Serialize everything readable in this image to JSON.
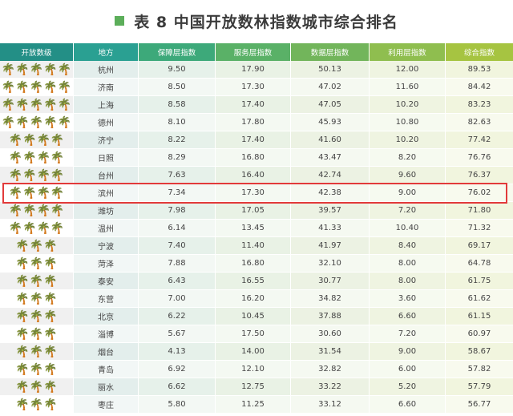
{
  "title": "表 8  中国开放数林指数城市综合排名",
  "headers": [
    "开放数级",
    "地方",
    "保障层指数",
    "服务层指数",
    "数据层指数",
    "利用层指数",
    "综合指数"
  ],
  "header_colors": [
    "#238f86",
    "#2aa092",
    "#3da97a",
    "#5ab167",
    "#72b55b",
    "#8fbe4f",
    "#a6c441"
  ],
  "rank_glyph": "🌴",
  "rows": [
    {
      "rank": "🌴🌴🌴🌴🌴",
      "city": "杭州",
      "v1": "9.50",
      "v2": "17.90",
      "v3": "50.13",
      "v4": "12.00",
      "v5": "89.53"
    },
    {
      "rank": "🌴🌴🌴🌴🌴",
      "city": "济南",
      "v1": "8.50",
      "v2": "17.30",
      "v3": "47.02",
      "v4": "11.60",
      "v5": "84.42"
    },
    {
      "rank": "🌴🌴🌴🌴🌴",
      "city": "上海",
      "v1": "8.58",
      "v2": "17.40",
      "v3": "47.05",
      "v4": "10.20",
      "v5": "83.23"
    },
    {
      "rank": "🌴🌴🌴🌴🌴",
      "city": "德州",
      "v1": "8.10",
      "v2": "17.80",
      "v3": "45.93",
      "v4": "10.80",
      "v5": "82.63"
    },
    {
      "rank": "🌴🌴🌴🌴",
      "city": "济宁",
      "v1": "8.22",
      "v2": "17.40",
      "v3": "41.60",
      "v4": "10.20",
      "v5": "77.42"
    },
    {
      "rank": "🌴🌴🌴🌴",
      "city": "日照",
      "v1": "8.29",
      "v2": "16.80",
      "v3": "43.47",
      "v4": "8.20",
      "v5": "76.76"
    },
    {
      "rank": "🌴🌴🌴🌴",
      "city": "台州",
      "v1": "7.63",
      "v2": "16.40",
      "v3": "42.74",
      "v4": "9.60",
      "v5": "76.37"
    },
    {
      "rank": "🌴🌴🌴🌴",
      "city": "滨州",
      "v1": "7.34",
      "v2": "17.30",
      "v3": "42.38",
      "v4": "9.00",
      "v5": "76.02"
    },
    {
      "rank": "🌴🌴🌴🌴",
      "city": "潍坊",
      "v1": "7.98",
      "v2": "17.05",
      "v3": "39.57",
      "v4": "7.20",
      "v5": "71.80"
    },
    {
      "rank": "🌴🌴🌴🌴",
      "city": "温州",
      "v1": "6.14",
      "v2": "13.45",
      "v3": "41.33",
      "v4": "10.40",
      "v5": "71.32"
    },
    {
      "rank": "🌴🌴🌴",
      "city": "宁波",
      "v1": "7.40",
      "v2": "11.40",
      "v3": "41.97",
      "v4": "8.40",
      "v5": "69.17"
    },
    {
      "rank": "🌴🌴🌴",
      "city": "菏泽",
      "v1": "7.88",
      "v2": "16.80",
      "v3": "32.10",
      "v4": "8.00",
      "v5": "64.78"
    },
    {
      "rank": "🌴🌴🌴",
      "city": "泰安",
      "v1": "6.43",
      "v2": "16.55",
      "v3": "30.77",
      "v4": "8.00",
      "v5": "61.75"
    },
    {
      "rank": "🌴🌴🌴",
      "city": "东营",
      "v1": "7.00",
      "v2": "16.20",
      "v3": "34.82",
      "v4": "3.60",
      "v5": "61.62"
    },
    {
      "rank": "🌴🌴🌴",
      "city": "北京",
      "v1": "6.22",
      "v2": "10.45",
      "v3": "37.88",
      "v4": "6.60",
      "v5": "61.15"
    },
    {
      "rank": "🌴🌴🌴",
      "city": "淄博",
      "v1": "5.67",
      "v2": "17.50",
      "v3": "30.60",
      "v4": "7.20",
      "v5": "60.97"
    },
    {
      "rank": "🌴🌴🌴",
      "city": "烟台",
      "v1": "4.13",
      "v2": "14.00",
      "v3": "31.54",
      "v4": "9.00",
      "v5": "58.67"
    },
    {
      "rank": "🌴🌴🌴",
      "city": "青岛",
      "v1": "6.92",
      "v2": "12.10",
      "v3": "32.82",
      "v4": "6.00",
      "v5": "57.82"
    },
    {
      "rank": "🌴🌴🌴",
      "city": "丽水",
      "v1": "6.62",
      "v2": "12.75",
      "v3": "33.22",
      "v4": "5.20",
      "v5": "57.79"
    },
    {
      "rank": "🌴🌴🌴",
      "city": "枣庄",
      "v1": "5.80",
      "v2": "11.25",
      "v3": "33.12",
      "v4": "6.60",
      "v5": "56.77"
    }
  ],
  "highlight_city": "滨州",
  "highlight_color": "#e23a3a",
  "col_fill_odd": [
    "#f0f0f0",
    "#e3eeec",
    "#e6f1ea",
    "#e9f2e5",
    "#ecf2e3",
    "#eff4e1",
    "#f1f5de"
  ],
  "col_fill_even": [
    "#ffffff",
    "#f2f7f6",
    "#f3f8f4",
    "#f4f9f2",
    "#f5f9f1",
    "#f6faf0",
    "#f8faee"
  ]
}
